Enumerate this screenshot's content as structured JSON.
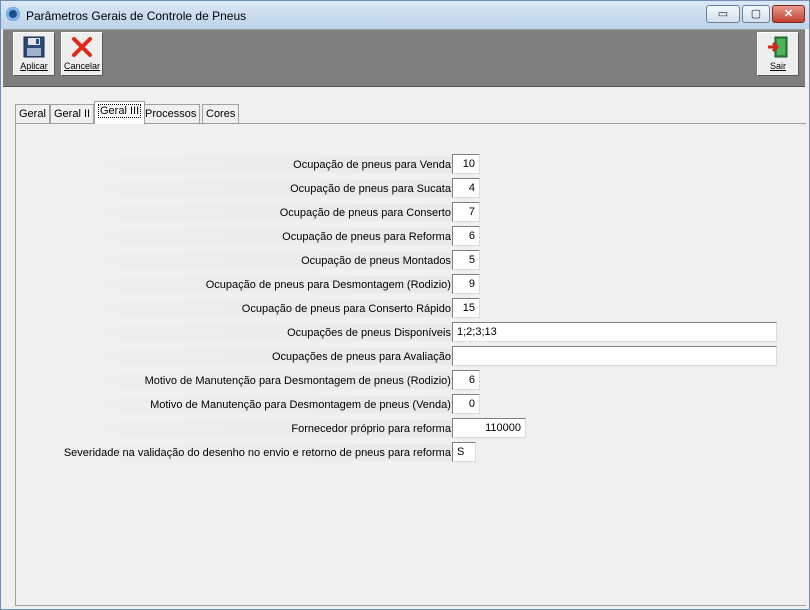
{
  "window": {
    "title": "Parâmetros Gerais de Controle de Pneus",
    "min_glyph": "▭",
    "max_glyph": "▢",
    "close_glyph": "✕"
  },
  "toolbar": {
    "apply_label": "Aplicar",
    "cancel_label": "Cancelar",
    "exit_label": "Sair"
  },
  "tabs": [
    {
      "label": "Geral"
    },
    {
      "label": "Geral II"
    },
    {
      "label": "Geral III"
    },
    {
      "label": "Processos"
    },
    {
      "label": "Cores"
    }
  ],
  "active_tab": "Geral III",
  "fields": [
    {
      "label": "Ocupação de pneus para Venda:",
      "value": "10"
    },
    {
      "label": "Ocupação de pneus para Sucata:",
      "value": "4"
    },
    {
      "label": "Ocupação de pneus para Conserto:",
      "value": "7"
    },
    {
      "label": "Ocupação de pneus para Reforma:",
      "value": "6"
    },
    {
      "label": "Ocupação de pneus Montados:",
      "value": "5"
    },
    {
      "label": "Ocupação de pneus para Desmontagem (Rodizio):",
      "value": "9"
    },
    {
      "label": "Ocupação de pneus para Conserto Rápido:",
      "value": "15"
    },
    {
      "label": "Ocupações de pneus Disponíveis:",
      "value": "1;2;3;13"
    },
    {
      "label": "Ocupações de pneus para Avaliação:",
      "value": ""
    },
    {
      "label": "Motivo de Manutenção para Desmontagem de pneus (Rodizio):",
      "value": "6"
    },
    {
      "label": "Motivo de Manutenção para Desmontagem de pneus (Venda):",
      "value": "0"
    },
    {
      "label": "Fornecedor próprio para reforma:",
      "value": "110000"
    },
    {
      "label": "Severidade na validação do desenho no envio e retorno de pneus para reforma:",
      "value": "S"
    }
  ],
  "colors": {
    "titlebar": "#bcd3ea",
    "toolbar": "#7f7f7f",
    "close": "#c2402f"
  }
}
